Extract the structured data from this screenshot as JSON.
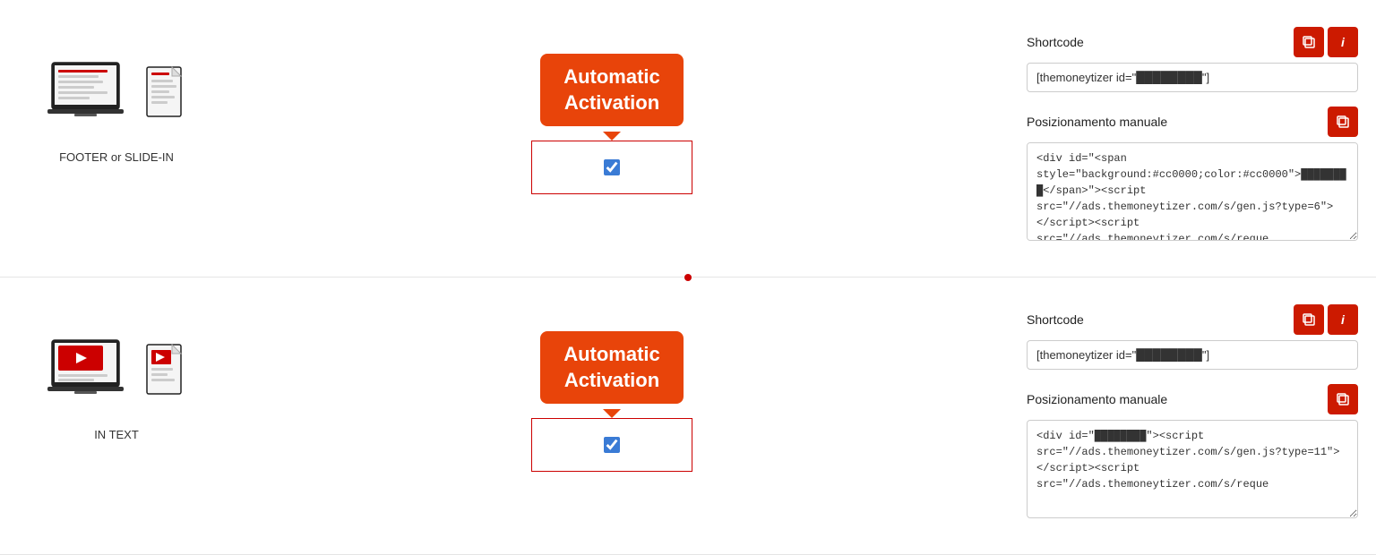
{
  "rows": [
    {
      "id": "footer-slide-in",
      "device_label": "FOOTER or SLIDE-IN",
      "tooltip_line1": "Automatic",
      "tooltip_line2": "Activation",
      "checkbox_checked": true,
      "shortcode_label": "Shortcode",
      "shortcode_value": "[themoneytizer id=\"████████\"]",
      "manual_label": "Posizionamento manuale",
      "manual_code": "<div id=\"████████\"><script src=\"//ads.themoneytizer.com/s/gen.js?type=6\"><\\/script><script src=\"//ads.themoneytizer.com/s/reque",
      "type": "footer",
      "icon_type": "document-lines"
    },
    {
      "id": "in-text",
      "device_label": "IN TEXT",
      "tooltip_line1": "Automatic",
      "tooltip_line2": "Activation",
      "checkbox_checked": true,
      "shortcode_label": "Shortcode",
      "shortcode_value": "[themoneytizer id=\"████████\"]",
      "manual_label": "Posizionamento manuale",
      "manual_code": "<div id=\"████████\"><script src=\"//ads.themoneytizer.com/s/gen.js?type=11\"><\\/script><script src=\"//ads.themoneytizer.com/s/reque",
      "type": "video",
      "icon_type": "video-play"
    }
  ],
  "copy_icon": "📋",
  "info_icon": "i",
  "labels": {
    "shortcode": "Shortcode",
    "manual": "Posizionamento manuale",
    "automatic_activation_line1": "Automatic",
    "automatic_activation_line2": "Activation"
  }
}
